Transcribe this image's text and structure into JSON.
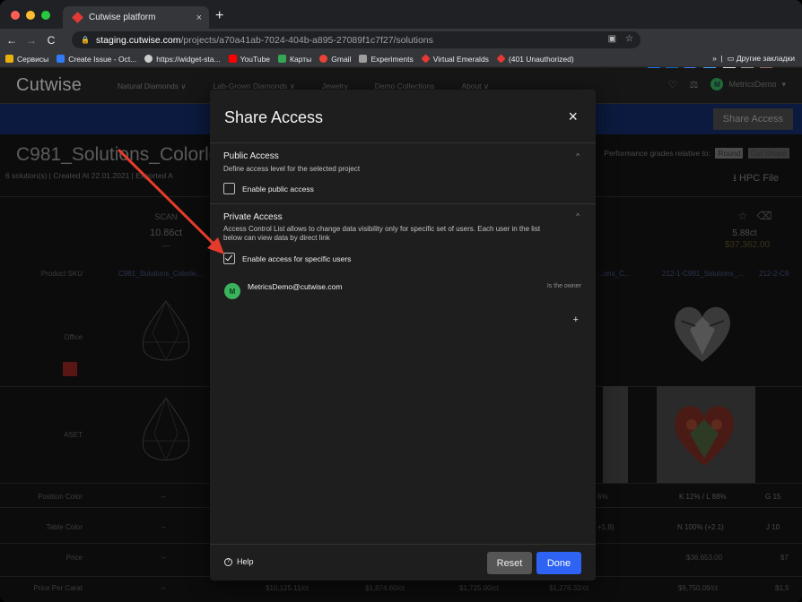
{
  "browser": {
    "tab_title": "Cutwise platform",
    "tab_close": "×",
    "new_tab": "+",
    "url_host": "staging.cutwise.com",
    "url_path": "/projects/a70a41ab-7024-404b-a895-27089f1c7f27/solutions",
    "nav": {
      "back": "←",
      "forward": "→",
      "reload": "C"
    },
    "bookmarks": [
      {
        "label": "Сервисы",
        "color": "#e8b10e"
      },
      {
        "label": "Create Issue - Oct...",
        "color": "#2f7cf6"
      },
      {
        "label": "https://widget-sta...",
        "color": "#cccccc"
      },
      {
        "label": "YouTube",
        "color": "#ff0000"
      },
      {
        "label": "Карты",
        "color": "#34a853"
      },
      {
        "label": "Gmail",
        "color": "#ea4335"
      },
      {
        "label": "Experiments",
        "color": "#9e9e9e"
      },
      {
        "label": "Virtual Emeralds",
        "color": "#e53935"
      },
      {
        "label": "(401 Unauthorized)",
        "color": "#e53935"
      }
    ],
    "bookmarks_more": "»",
    "other_bookmarks": "Другие закладки"
  },
  "app": {
    "logo": "Cutwise",
    "nav_links": [
      "Natural Diamonds ∨",
      "Lab-Grown Diamonds ∨",
      "Jewelry",
      "Demo Collections",
      "About ∨"
    ],
    "user_initial": "M",
    "user_name": "MetricsDemo",
    "share_button": "Share Access",
    "project_title": "C981_Solutions_Colorle",
    "project_meta": "6 solution(s) | Created At 22.01.2021 | Exported A",
    "grades_text": "Performance grades relative to:",
    "grade_chips": [
      "Round",
      "Cut Shape"
    ],
    "hpc_file": "HPC File",
    "scan_label": "SCAN",
    "scan_weight": "10.86ct",
    "scan_dash": "—",
    "right_weight": "5.88ct",
    "right_price": "$37,362.00",
    "row_labels": [
      "Product SKU",
      "Office",
      "ASET",
      "Position Color",
      "Table Color",
      "Price",
      "Price Per Carat"
    ],
    "sku_values": [
      "C981_Solutions_Colorle...",
      "...ons_C...",
      "212-1-C981_Solutions_...",
      "212-2-C9"
    ],
    "position_values": [
      "–",
      "6%",
      "K 12% / L 88%",
      "G 15"
    ],
    "table_values": [
      "–",
      "+1.8)",
      "N 100% (+2.1)",
      "J 10"
    ],
    "price_values": [
      "–",
      "$36,653.00",
      "$7"
    ],
    "ppc_values": [
      "–",
      "$10,125.11/ct",
      "$1,874.60/ct",
      "$1,725.00/ct",
      "$1,276.32/ct",
      "$6,750.09/ct",
      "$1,5"
    ]
  },
  "modal": {
    "title": "Share Access",
    "close": "×",
    "public": {
      "title": "Public Access",
      "description": "Define access level for the selected project",
      "checkbox_label": "Enable public access",
      "checked": false,
      "caret": "^"
    },
    "private": {
      "title": "Private Access",
      "description_1": "Access Control List allows to change data visibility only for specific set of users. Each user in the list",
      "description_2": "below can view data by direct link",
      "checkbox_label": "Enable access for specific users",
      "checked": true,
      "caret": "^"
    },
    "user": {
      "initial": "M",
      "email": "MetricsDemo@cutwise.com",
      "role": "Is the owner"
    },
    "add_user": "+",
    "help": "Help",
    "reset": "Reset",
    "done": "Done",
    "colors": {
      "done": "#2f63f4",
      "avatar": "#3bb35d",
      "arrow": "#e53b2a"
    }
  }
}
